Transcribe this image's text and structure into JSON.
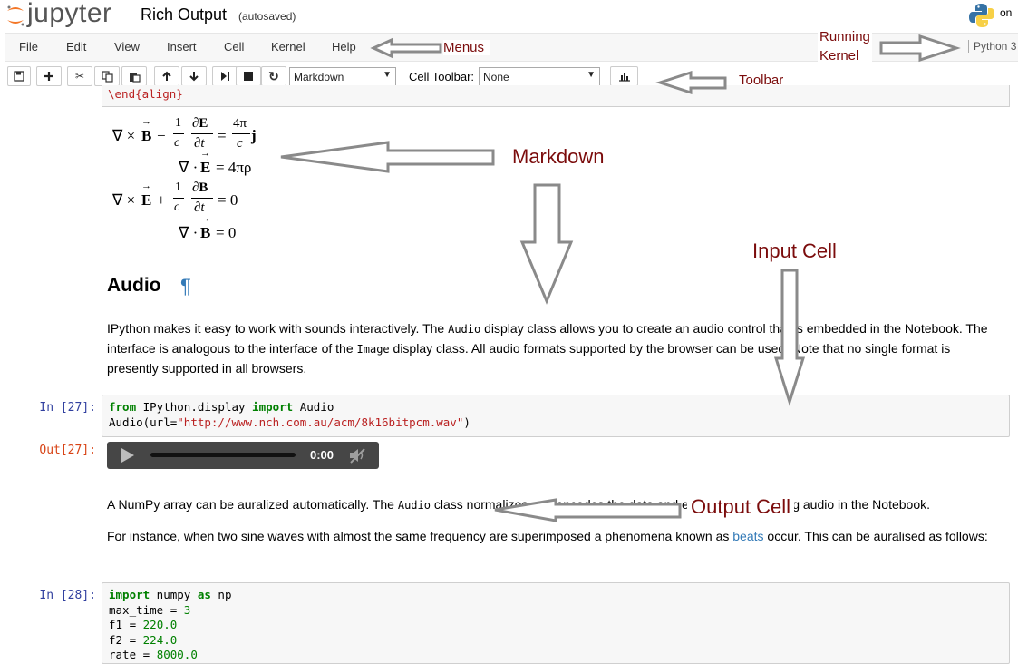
{
  "header": {
    "logo_text": "jupyter",
    "notebook_name": "Rich Output",
    "autosave_status": "(autosaved)",
    "user_text": "on"
  },
  "menubar": {
    "items": [
      "File",
      "Edit",
      "View",
      "Insert",
      "Cell",
      "Kernel",
      "Help"
    ],
    "kernel_name": "Python 3"
  },
  "toolbar": {
    "cell_type": "Markdown",
    "cell_toolbar_label": "Cell Toolbar:",
    "cell_toolbar_value": "None"
  },
  "cells": {
    "prev_code_tail": "\\end{align}",
    "math": {
      "eq1": {
        "lhs_a": "∇ × ",
        "B": "B",
        "minus": "−",
        "frac_num": "1",
        "frac_den": "c",
        "d_num": "∂E",
        "d_den": "∂t",
        "eq": "=",
        "rhs_num": "4π",
        "rhs_den": "c",
        "j": "j"
      },
      "eq2": {
        "lhs": "∇ · ",
        "E": "E",
        "rhs": "= 4πρ"
      },
      "eq3": {
        "lhs_a": "∇ × ",
        "E": "E",
        "plus": "+",
        "frac_num": "1",
        "frac_den": "c",
        "d_num": "∂B",
        "d_den": "∂t",
        "rhs": "= 0"
      },
      "eq4": {
        "lhs": "∇ · ",
        "B": "B",
        "rhs": "= 0"
      }
    },
    "audio_heading": "Audio",
    "pilcrow": "¶",
    "audio_para": {
      "t1": "IPython makes it easy to work with sounds interactively. The ",
      "c1": "Audio",
      "t2": " display class allows you to create an audio control that is embedded in the Notebook. The interface is analogous to the interface of the ",
      "c2": "Image",
      "t3": " display class. All audio formats supported by the browser can be used. Note that no single format is presently supported in all browsers."
    },
    "cell27": {
      "in_prompt": "In [27]:",
      "out_prompt": "Out[27]:",
      "l1_kw1": "from",
      "l1_mod": " IPython.display ",
      "l1_kw2": "import",
      "l1_name": " Audio",
      "l2_a": "Audio(url=",
      "l2_str": "\"http://www.nch.com.au/acm/8k16bitpcm.wav\"",
      "l2_b": ")",
      "player_time": "0:00"
    },
    "numpy_para": {
      "t1": "A NumPy array can be auralized automatically. The ",
      "c1": "Audio",
      "t2": " class normalizes and encodes the data and embeds the resulting audio in the Notebook."
    },
    "beats_para": {
      "t1": "For instance, when two sine waves with almost the same frequency are superimposed a phenomena known as ",
      "link": "beats",
      "t2": " occur. This can be auralised as follows:"
    },
    "cell28": {
      "in_prompt": "In [28]:",
      "l1_kw1": "import",
      "l1_mod": " numpy ",
      "l1_kw2": "as",
      "l1_name": " np",
      "l2_a": "max_time = ",
      "l2_n": "3",
      "l3_a": "f1 = ",
      "l3_n": "220.0",
      "l4_a": "f2 = ",
      "l4_n": "224.0",
      "l5_a": "rate = ",
      "l5_n": "8000.0"
    }
  },
  "annotations": {
    "menus": "Menus",
    "running_kernel_1": "Running",
    "running_kernel_2": "Kernel",
    "toolbar": "Toolbar",
    "markdown": "Markdown",
    "input_cell": "Input Cell",
    "output_cell": "Output Cell"
  },
  "colors": {
    "annotation": "#7b0c0c",
    "arrow": "#8a8a8a",
    "link": "#337ab7",
    "keyword": "#008000",
    "string": "#ba2121"
  }
}
